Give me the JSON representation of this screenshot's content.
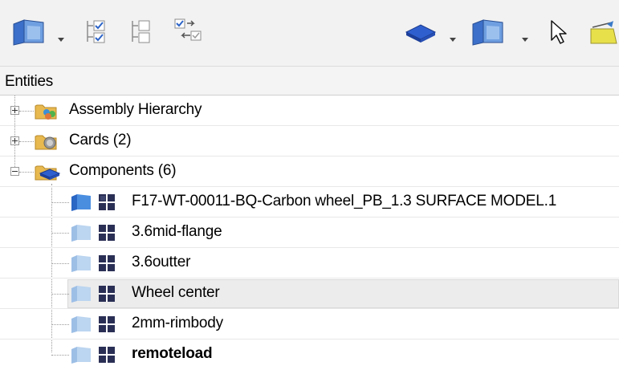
{
  "toolbar": {
    "left_icons": [
      "component-display-icon",
      "checklist-icon",
      "checklist-empty-icon",
      "swap-list-icon"
    ],
    "right_icons": [
      "blue-solid-icon",
      "component-display-icon",
      "cursor-arrow-icon",
      "folder-arrow-icon"
    ]
  },
  "header": {
    "title": "Entities"
  },
  "tree": {
    "nodes": [
      {
        "label": "Assembly Hierarchy",
        "icon": "assembly-folder-icon",
        "expanded": false
      },
      {
        "label": "Cards (2)",
        "icon": "cards-folder-icon",
        "expanded": false
      },
      {
        "label": "Components (6)",
        "icon": "components-folder-icon",
        "expanded": true,
        "children": [
          {
            "label": "F17-WT-00011-BQ-Carbon wheel_PB_1.3 SURFACE MODEL.1",
            "bold": false,
            "selected": false
          },
          {
            "label": "3.6mid-flange",
            "bold": false,
            "selected": false
          },
          {
            "label": "3.6outter",
            "bold": false,
            "selected": false
          },
          {
            "label": "Wheel center",
            "bold": false,
            "selected": true
          },
          {
            "label": "2mm-rimbody",
            "bold": false,
            "selected": false
          },
          {
            "label": "remoteload",
            "bold": true,
            "selected": false
          }
        ]
      }
    ]
  },
  "colors": {
    "toolbar_bg": "#f2f2f2",
    "header_bg": "#f4f4f4",
    "selected_row": "#ececec",
    "component_blue": "#2f7fd6",
    "component_blue_faded": "#a9c9ea",
    "grid_dark": "#2a2f55"
  }
}
